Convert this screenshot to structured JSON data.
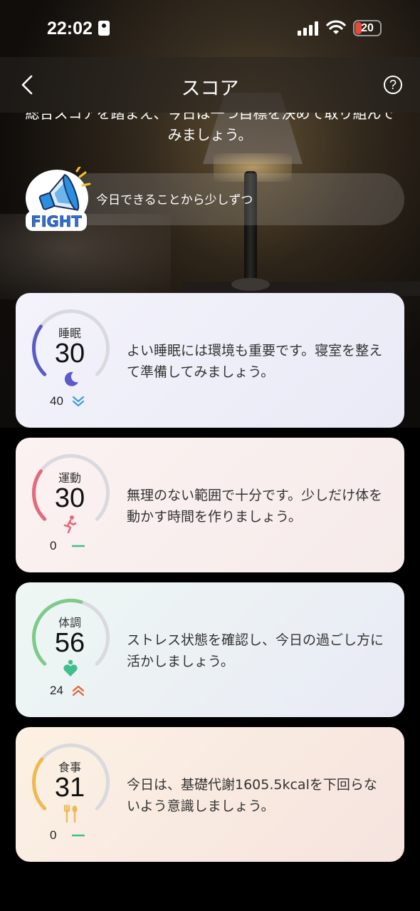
{
  "statusbar": {
    "time": "22:02",
    "battery": "20"
  },
  "nav": {
    "title": "スコア"
  },
  "intro": {
    "text": "総合スコアを踏まえ、今日は一つ目標を決めて取り組んでみましょう。"
  },
  "fight": {
    "badge_text": "FIGHT",
    "message": "今日できることから少しずつ"
  },
  "cards": [
    {
      "label": "睡眠",
      "score": "30",
      "score_value": 30,
      "trend_value": "40",
      "trend": "down",
      "icon": "moon-icon",
      "color": "#5a5bc7",
      "message": "よい睡眠には環境も重要です。寝室を整えて準備してみましょう。"
    },
    {
      "label": "運動",
      "score": "30",
      "score_value": 30,
      "trend_value": "0",
      "trend": "flat",
      "icon": "running-icon",
      "color": "#e36a7a",
      "message": "無理のない範囲で十分です。少しだけ体を動かす時間を作りましょう。"
    },
    {
      "label": "体調",
      "score": "56",
      "score_value": 56,
      "trend_value": "24",
      "trend": "up",
      "icon": "heart-icon",
      "color": "#7ccb8b",
      "message": "ストレス状態を確認し、今日の過ごし方に活かしましょう。"
    },
    {
      "label": "食事",
      "score": "31",
      "score_value": 31,
      "trend_value": "0",
      "trend": "flat",
      "icon": "fork-spoon-icon",
      "color": "#efb94f",
      "message": "今日は、基礎代謝1605.5kcalを下回らないよう意識しましょう。"
    }
  ]
}
